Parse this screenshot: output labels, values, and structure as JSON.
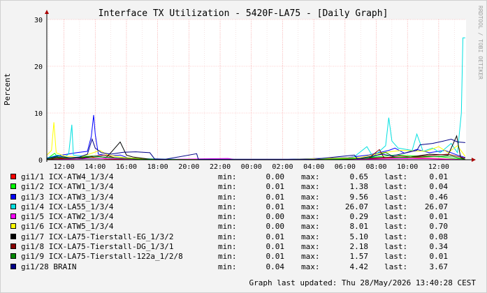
{
  "chart_data": {
    "type": "line",
    "title": "Interface TX Utilization - 5420F-LA75 - [Daily Graph]",
    "ylabel": "Percent",
    "xlabel": "",
    "side_label": "RRDTOOL / TOBI OETIKER",
    "ylim": [
      0,
      30
    ],
    "yticks": [
      0,
      10,
      20,
      30
    ],
    "xlim": [
      10.9,
      13.75
    ],
    "xlim_note": "hours of day, wrapping past midnight (10.9 -> 37.75)",
    "xticks": [
      {
        "h": 12,
        "label": "12:00"
      },
      {
        "h": 14,
        "label": "14:00"
      },
      {
        "h": 16,
        "label": "16:00"
      },
      {
        "h": 18,
        "label": "18:00"
      },
      {
        "h": 20,
        "label": "20:00"
      },
      {
        "h": 22,
        "label": "22:00"
      },
      {
        "h": 24,
        "label": "00:00"
      },
      {
        "h": 26,
        "label": "02:00"
      },
      {
        "h": 28,
        "label": "04:00"
      },
      {
        "h": 30,
        "label": "06:00"
      },
      {
        "h": 32,
        "label": "08:00"
      },
      {
        "h": 34,
        "label": "10:00"
      },
      {
        "h": 36,
        "label": "12:00"
      }
    ],
    "grid": true,
    "series": [
      {
        "name": "gi1/1 ICX-ATW4_1/3/4",
        "color": "#ff0000",
        "min": "0.00",
        "max": "0.65",
        "last": "0.01",
        "points": [
          [
            10.9,
            0.1
          ],
          [
            11.3,
            0.4
          ],
          [
            12.6,
            0.3
          ],
          [
            13.6,
            0.65
          ],
          [
            14.6,
            0.2
          ],
          [
            16.0,
            0.1
          ],
          [
            19,
            0.02
          ],
          [
            24,
            0.02
          ],
          [
            30.5,
            0.1
          ],
          [
            32.8,
            0.4
          ],
          [
            34.2,
            0.5
          ],
          [
            35.5,
            0.3
          ],
          [
            37.7,
            0.01
          ]
        ]
      },
      {
        "name": "gi1/2 ICX-ATW1_1/3/4",
        "color": "#00ff00",
        "min": "0.01",
        "max": "1.38",
        "last": "0.04",
        "points": [
          [
            10.9,
            0.2
          ],
          [
            11.4,
            1.38
          ],
          [
            11.7,
            0.2
          ],
          [
            12.8,
            0.5
          ],
          [
            14.5,
            0.3
          ],
          [
            16.2,
            0.2
          ],
          [
            20,
            0.02
          ],
          [
            26,
            0.02
          ],
          [
            31.0,
            0.3
          ],
          [
            33.2,
            1.0
          ],
          [
            34.6,
            0.8
          ],
          [
            36.2,
            0.6
          ],
          [
            37.7,
            0.04
          ]
        ]
      },
      {
        "name": "gi1/3 ICX-ATW3_1/3/4",
        "color": "#0000ff",
        "min": "0.01",
        "max": "9.56",
        "last": "0.46",
        "points": [
          [
            10.9,
            0.3
          ],
          [
            11.5,
            0.8
          ],
          [
            12.8,
            1.5
          ],
          [
            13.5,
            1.8
          ],
          [
            13.75,
            5.0
          ],
          [
            13.9,
            9.56
          ],
          [
            14.0,
            5.5
          ],
          [
            14.2,
            1.2
          ],
          [
            14.9,
            0.8
          ],
          [
            15.6,
            1.0
          ],
          [
            16.1,
            0.4
          ],
          [
            18,
            0.1
          ],
          [
            22,
            0.05
          ],
          [
            26,
            0.05
          ],
          [
            30.2,
            0.5
          ],
          [
            31.5,
            1.0
          ],
          [
            32.8,
            2.0
          ],
          [
            33.2,
            2.5
          ],
          [
            33.8,
            1.4
          ],
          [
            34.6,
            2.2
          ],
          [
            35.4,
            1.5
          ],
          [
            36.4,
            2.0
          ],
          [
            37.2,
            1.0
          ],
          [
            37.7,
            0.46
          ]
        ]
      },
      {
        "name": "gi1/4 ICX-LA55_1/3/4",
        "color": "#00e0e0",
        "min": "0.01",
        "max": "26.07",
        "last": "26.07",
        "points": [
          [
            10.9,
            0.4
          ],
          [
            11.6,
            1.0
          ],
          [
            12.0,
            0.6
          ],
          [
            12.3,
            1.2
          ],
          [
            12.5,
            7.5
          ],
          [
            12.6,
            1.0
          ],
          [
            13.2,
            0.8
          ],
          [
            14.4,
            0.6
          ],
          [
            16,
            0.3
          ],
          [
            20,
            0.05
          ],
          [
            26,
            0.05
          ],
          [
            30.5,
            0.4
          ],
          [
            31.4,
            2.8
          ],
          [
            31.8,
            0.6
          ],
          [
            32.6,
            3.0
          ],
          [
            32.8,
            9.0
          ],
          [
            33.0,
            4.0
          ],
          [
            33.4,
            2.5
          ],
          [
            34.3,
            2.0
          ],
          [
            34.6,
            5.5
          ],
          [
            35.0,
            1.8
          ],
          [
            35.6,
            2.5
          ],
          [
            36.1,
            1.5
          ],
          [
            36.8,
            3.5
          ],
          [
            37.2,
            1.5
          ],
          [
            37.45,
            10.0
          ],
          [
            37.55,
            26.07
          ],
          [
            37.7,
            26.07
          ]
        ]
      },
      {
        "name": "gi1/5 ICX-ATW2_1/3/4",
        "color": "#ff00ff",
        "min": "0.00",
        "max": "0.29",
        "last": "0.01",
        "points": [
          [
            10.9,
            0.05
          ],
          [
            12.8,
            0.2
          ],
          [
            14.5,
            0.29
          ],
          [
            18,
            0.05
          ],
          [
            22.5,
            0.29
          ],
          [
            23,
            0.02
          ],
          [
            28,
            0.02
          ],
          [
            32.6,
            0.2
          ],
          [
            35,
            0.25
          ],
          [
            37.7,
            0.01
          ]
        ]
      },
      {
        "name": "gi1/6 ICX-ATW5_1/3/4",
        "color": "#ffff00",
        "min": "0.00",
        "max": "8.01",
        "last": "0.70",
        "points": [
          [
            10.9,
            1.0
          ],
          [
            11.2,
            2.0
          ],
          [
            11.35,
            8.01
          ],
          [
            11.5,
            1.5
          ],
          [
            12.0,
            0.8
          ],
          [
            13.0,
            0.5
          ],
          [
            14.3,
            2.0
          ],
          [
            14.8,
            1.0
          ],
          [
            15.8,
            0.5
          ],
          [
            18,
            0.05
          ],
          [
            26,
            0.02
          ],
          [
            31.0,
            0.5
          ],
          [
            32.4,
            1.5
          ],
          [
            33.6,
            2.0
          ],
          [
            35.2,
            1.8
          ],
          [
            36.0,
            2.8
          ],
          [
            36.6,
            1.5
          ],
          [
            37.2,
            3.0
          ],
          [
            37.7,
            0.7
          ]
        ]
      },
      {
        "name": "gi1/7 ICX-LA75-Tierstall-EG_1/3/2",
        "color": "#000000",
        "min": "0.01",
        "max": "5.10",
        "last": "0.08",
        "points": [
          [
            10.9,
            0.2
          ],
          [
            11.8,
            0.5
          ],
          [
            13.2,
            0.3
          ],
          [
            14.0,
            0.8
          ],
          [
            14.7,
            0.5
          ],
          [
            15.0,
            1.5
          ],
          [
            15.6,
            3.8
          ],
          [
            16.0,
            1.0
          ],
          [
            16.4,
            0.6
          ],
          [
            17.5,
            0.1
          ],
          [
            19,
            0.02
          ],
          [
            28,
            0.02
          ],
          [
            30.5,
            0.2
          ],
          [
            32.5,
            0.5
          ],
          [
            34.0,
            0.5
          ],
          [
            35.4,
            1.2
          ],
          [
            36.6,
            1.0
          ],
          [
            37.15,
            5.1
          ],
          [
            37.4,
            0.5
          ],
          [
            37.7,
            0.08
          ]
        ]
      },
      {
        "name": "gi1/8 ICX-LA75-Tierstall-DG_1/3/1",
        "color": "#880000",
        "min": "0.01",
        "max": "2.18",
        "last": "0.34",
        "points": [
          [
            10.9,
            0.1
          ],
          [
            12.6,
            0.3
          ],
          [
            14.6,
            1.0
          ],
          [
            15.3,
            0.4
          ],
          [
            17,
            0.1
          ],
          [
            22,
            0.02
          ],
          [
            28,
            0.02
          ],
          [
            31.5,
            0.3
          ],
          [
            32.2,
            2.18
          ],
          [
            32.5,
            0.4
          ],
          [
            33.5,
            0.8
          ],
          [
            34.2,
            0.6
          ],
          [
            36.6,
            1.2
          ],
          [
            37.7,
            0.34
          ]
        ]
      },
      {
        "name": "gi1/9 ICX-LA75-Tierstall-122a_1/2/8",
        "color": "#008800",
        "min": "0.01",
        "max": "1.57",
        "last": "0.01",
        "points": [
          [
            10.9,
            0.1
          ],
          [
            11.5,
            0.6
          ],
          [
            12.5,
            0.3
          ],
          [
            13.8,
            0.8
          ],
          [
            15.2,
            0.4
          ],
          [
            17,
            0.1
          ],
          [
            22,
            0.02
          ],
          [
            28,
            0.02
          ],
          [
            31.4,
            0.3
          ],
          [
            32.6,
            1.57
          ],
          [
            33.2,
            0.5
          ],
          [
            35.0,
            0.6
          ],
          [
            36.8,
            0.8
          ],
          [
            37.7,
            0.01
          ]
        ]
      },
      {
        "name": "gi1/28 BRAIN",
        "color": "#000088",
        "min": "0.04",
        "max": "4.42",
        "last": "3.67",
        "points": [
          [
            10.9,
            0.3
          ],
          [
            11.6,
            0.8
          ],
          [
            12.4,
            0.4
          ],
          [
            13.0,
            0.6
          ],
          [
            13.5,
            1.2
          ],
          [
            13.8,
            4.42
          ],
          [
            14.0,
            2.5
          ],
          [
            14.4,
            1.5
          ],
          [
            15.0,
            1.2
          ],
          [
            15.8,
            1.6
          ],
          [
            16.6,
            1.7
          ],
          [
            17.5,
            1.5
          ],
          [
            17.8,
            0.2
          ],
          [
            18.5,
            0.1
          ],
          [
            20.5,
            1.3
          ],
          [
            20.6,
            0.1
          ],
          [
            24,
            0.1
          ],
          [
            28,
            0.1
          ],
          [
            30.6,
            1.0
          ],
          [
            30.8,
            0.2
          ],
          [
            32.4,
            1.2
          ],
          [
            33.0,
            0.8
          ],
          [
            34.6,
            2.0
          ],
          [
            34.8,
            3.2
          ],
          [
            35.6,
            3.5
          ],
          [
            36.3,
            4.0
          ],
          [
            36.8,
            4.4
          ],
          [
            37.2,
            3.8
          ],
          [
            37.7,
            3.67
          ]
        ]
      }
    ]
  },
  "legend_labels": {
    "min": "min:",
    "max": "max:",
    "last": "last:"
  },
  "footer": {
    "updated": "Graph last updated: Thu 28/May/2026 13:40:28 CEST"
  }
}
